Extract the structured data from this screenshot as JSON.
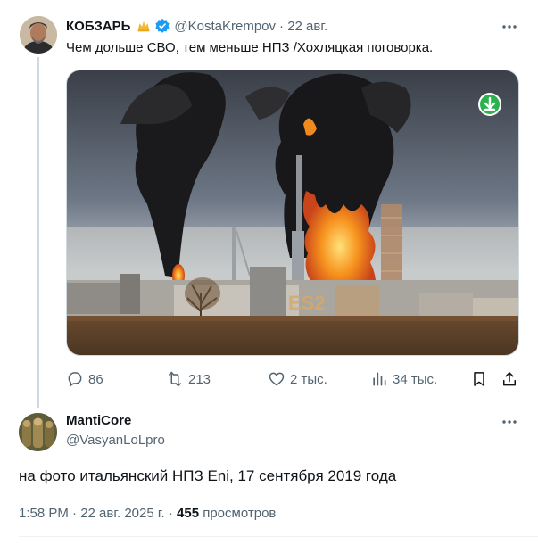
{
  "tweet": {
    "author_name": "КОБЗАРЬ",
    "author_handle": "@KostaKrempov",
    "date": "· 22 авг.",
    "text": "Чем дольше СВО, тем меньше НПЗ /Хохляцкая поговорка.",
    "media": {
      "overlay_text": "ES2",
      "download_icon": "arrow-down-icon"
    },
    "actions": {
      "replies": "86",
      "reposts": "213",
      "likes": "2 тыс.",
      "views": "34 тыс."
    }
  },
  "reply": {
    "author_name": "MantiCore",
    "author_handle": "@VasyanLoLpro",
    "text": "на фото итальянский НПЗ Eni, 17 сентября 2019 года",
    "timestamp": "1:58 PM · 22 авг. 2025 г. ·",
    "views_count": "455",
    "views_label": "просмотров"
  },
  "colors": {
    "verified_blue": "#1d9bf0",
    "secondary_text": "#536471",
    "download_green": "#2bb24c",
    "fire_orange": "#f08a1c"
  }
}
